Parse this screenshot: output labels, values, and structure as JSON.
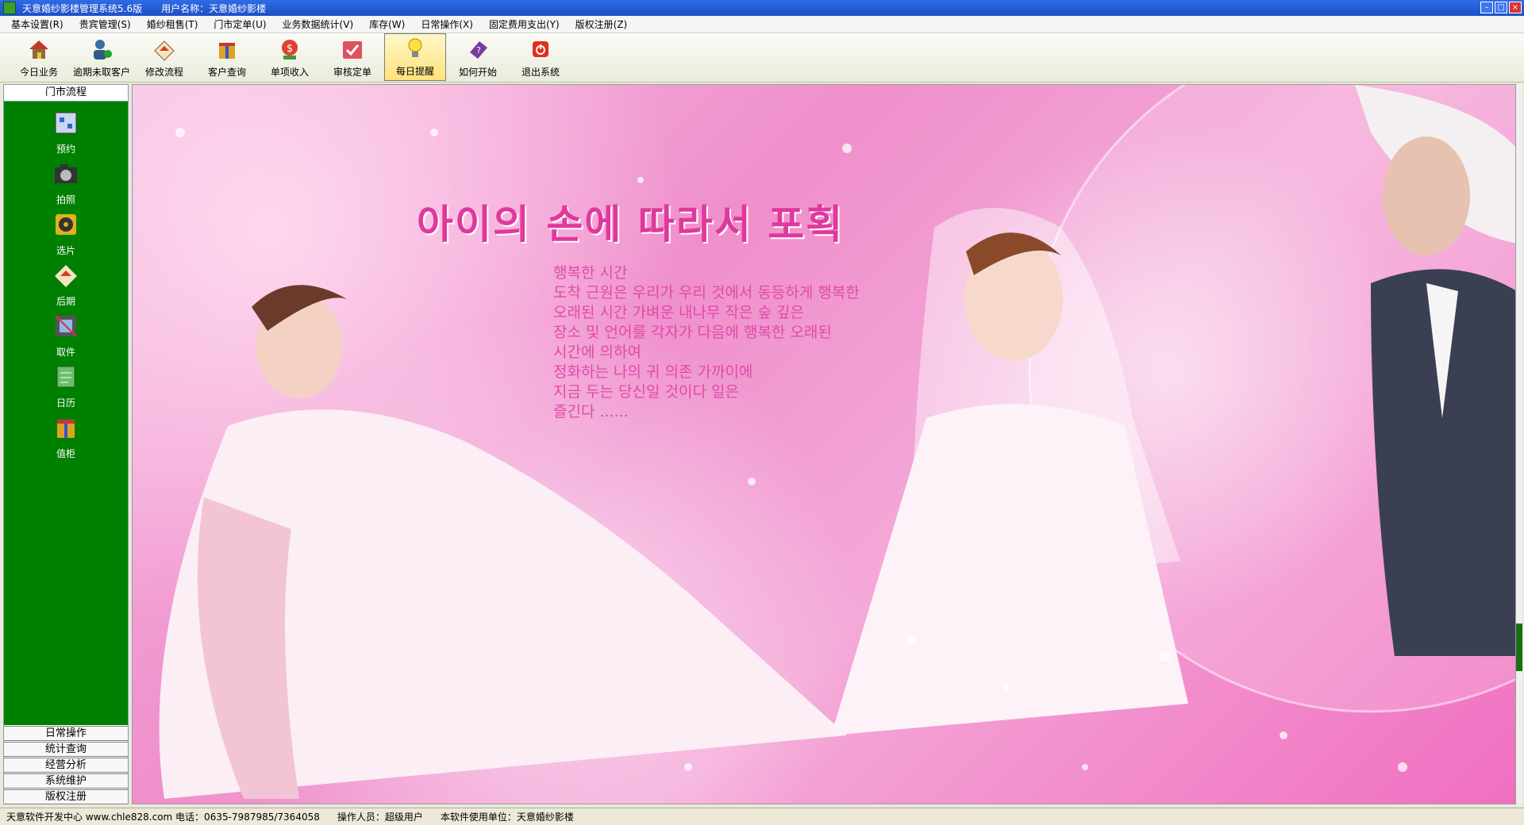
{
  "window": {
    "title": "天意婚纱影楼管理系统5.6版",
    "user_label": "用户名称：天意婚纱影楼"
  },
  "menu": [
    "基本设置(R)",
    "贵宾管理(S)",
    "婚纱租售(T)",
    "门市定单(U)",
    "业务数据统计(V)",
    "库存(W)",
    "日常操作(X)",
    "固定费用支出(Y)",
    "版权注册(Z)"
  ],
  "toolbar": [
    {
      "label": "今日业务",
      "icon": "house-icon"
    },
    {
      "label": "逾期未取客户",
      "icon": "user-icon"
    },
    {
      "label": "修改流程",
      "icon": "edit-icon"
    },
    {
      "label": "客户查询",
      "icon": "gift-icon"
    },
    {
      "label": "单项收入",
      "icon": "money-icon"
    },
    {
      "label": "审核定单",
      "icon": "check-icon"
    },
    {
      "label": "每日提醒",
      "icon": "bulb-icon",
      "active": true
    },
    {
      "label": "如何开始",
      "icon": "book-icon"
    },
    {
      "label": "退出系统",
      "icon": "power-icon"
    }
  ],
  "sidebar": {
    "header": "门市流程",
    "items": [
      {
        "label": "预约",
        "icon": "calendar-icon"
      },
      {
        "label": "拍照",
        "icon": "camera-icon"
      },
      {
        "label": "选片",
        "icon": "disc-icon"
      },
      {
        "label": "后期",
        "icon": "edit-icon"
      },
      {
        "label": "取件",
        "icon": "film-icon"
      },
      {
        "label": "日历",
        "icon": "notebook-icon"
      },
      {
        "label": "值柜",
        "icon": "gift-icon"
      }
    ],
    "bottom": [
      "日常操作",
      "统计查询",
      "经营分析",
      "系统维护",
      "版权注册"
    ]
  },
  "banner": {
    "headline": "아이의 손에 따라서 포획",
    "poem": [
      "행복한 시간",
      "도착 근원은 우리가 우리 것에서 동등하게 행복한",
      "오래된 시간 가벼운 내나무 작은 숲 깊은",
      "장소 및 언어를 각자가 다음에 행복한 오래된",
      "시간에 의하여",
      "정화하는 나의 귀 의존 가까이에",
      "지금 두는 당신일 것이다 일은",
      "즐긴다 ......"
    ]
  },
  "status": {
    "dev": "天意软件开发中心 www.chle828.com 电话：0635-7987985/7364058",
    "operator": "操作人员：超级用户",
    "unit": "本软件使用单位：天意婚纱影楼"
  },
  "colors": {
    "sidebar_green": "#008000",
    "title_blue": "#1d4fc6",
    "banner_pink": "#ef8fcc"
  }
}
